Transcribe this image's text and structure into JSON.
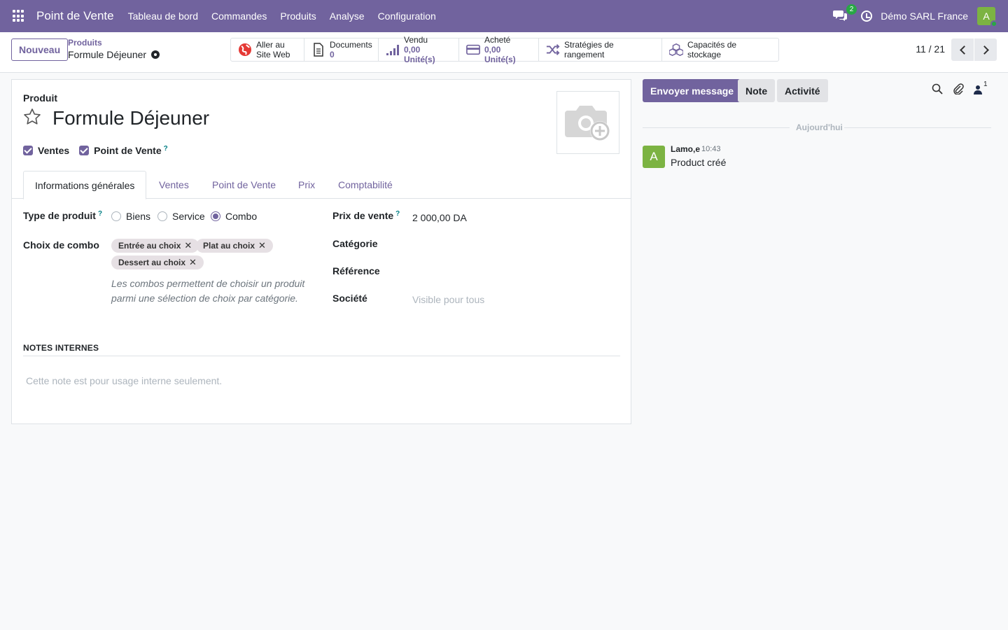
{
  "navbar": {
    "brand": "Point de Vente",
    "menu": [
      "Tableau de bord",
      "Commandes",
      "Produits",
      "Analyse",
      "Configuration"
    ],
    "chat_count": "2",
    "company": "Démo SARL France",
    "avatar_letter": "A"
  },
  "control": {
    "new_label": "Nouveau",
    "breadcrumb_parent": "Produits",
    "breadcrumb_current": "Formule Déjeuner",
    "smart_buttons": [
      {
        "line1": "Aller au",
        "line2": "Site Web",
        "icon": "globe-icon"
      },
      {
        "line1": "Documents",
        "line2": "0",
        "icon": "document-icon"
      },
      {
        "line1": "Vendu",
        "line2": "0,00 Unité(s)",
        "icon": "signal-icon"
      },
      {
        "line1": "Acheté",
        "line2": "0,00 Unité(s)",
        "icon": "credit-card-icon"
      },
      {
        "line1": "Stratégies de rangement",
        "icon": "shuffle-icon"
      },
      {
        "line1": "Capacités de stockage",
        "icon": "cubes-icon"
      }
    ],
    "pager": "11 / 21"
  },
  "form": {
    "record_label": "Produit",
    "title": "Formule Déjeuner",
    "checkboxes": [
      "Ventes",
      "Point de Vente"
    ],
    "help_mark": "?",
    "tabs": [
      "Informations générales",
      "Ventes",
      "Point de Vente",
      "Prix",
      "Comptabilité"
    ],
    "active_tab": 0,
    "type_label": "Type de produit",
    "type_options": [
      "Biens",
      "Service",
      "Combo"
    ],
    "type_selected": "Combo",
    "combo_label": "Choix de combo",
    "combo_tags": [
      "Entrée au choix",
      "Plat au choix",
      "Dessert au choix"
    ],
    "tag_remove": "✕",
    "combo_hint": "Les combos permettent de choisir un produit parmi une sélection de choix par catégorie.",
    "price_label": "Prix de vente",
    "price_value": "2 000,00 DA",
    "category_label": "Catégorie",
    "reference_label": "Référence",
    "company_label": "Société",
    "company_placeholder": "Visible pour tous",
    "notes_title": "NOTES INTERNES",
    "notes_placeholder": "Cette note est pour usage interne seulement."
  },
  "chatter": {
    "send_label": "Envoyer message",
    "note_label": "Note",
    "activity_label": "Activité",
    "followers_count": "1",
    "today_label": "Aujourd'hui",
    "message": {
      "avatar": "A",
      "author": "Lamo,e",
      "time": "10:43",
      "body": "Product créé"
    }
  },
  "colors": {
    "brand": "#71639e",
    "accent_green": "#28a745",
    "avatar_green": "#7cb342"
  }
}
